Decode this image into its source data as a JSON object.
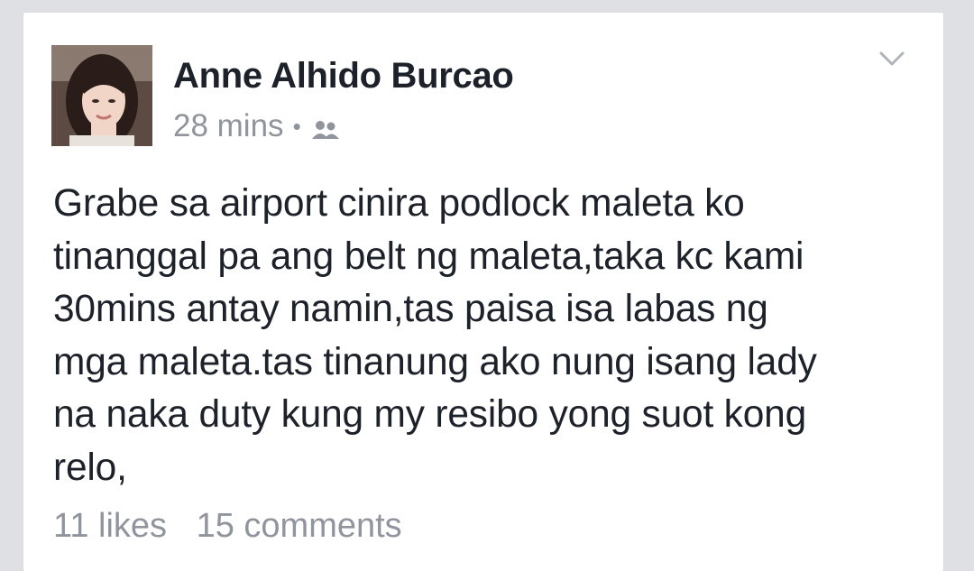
{
  "post": {
    "author": "Anne Alhido Burcao",
    "timestamp": "28 mins",
    "separator": "•",
    "audience_icon": "friends-icon",
    "menu_icon": "chevron-down-icon",
    "text_lines": [
      "Grabe sa airport cinira  podlock maleta ko",
      "tinanggal pa ang belt ng maleta,taka kc kami",
      "30mins antay namin,tas paisa isa labas ng",
      "mga maleta.tas tinanung ako nung isang lady",
      "na naka duty kung my resibo yong suot kong",
      "relo,"
    ],
    "likes": "11 likes",
    "comments": "15 comments"
  },
  "colors": {
    "background": "#dfe0e4",
    "card": "#ffffff",
    "text": "#1d2129",
    "meta": "#90949c"
  }
}
